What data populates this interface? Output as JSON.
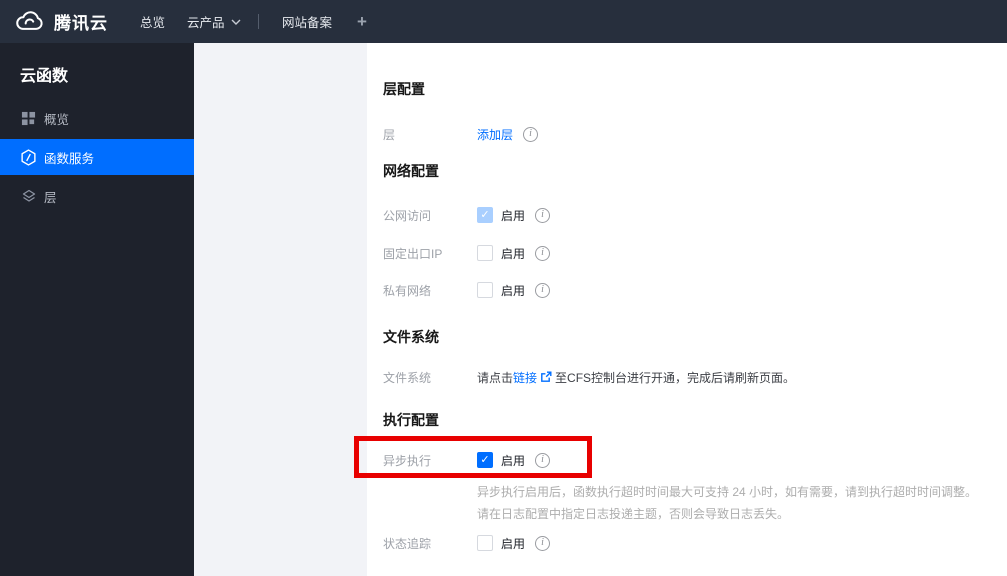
{
  "topbar": {
    "brand": "腾讯云",
    "nav": [
      {
        "label": "总览"
      },
      {
        "label": "云产品"
      },
      {
        "label": "网站备案"
      }
    ],
    "plus_label": "+"
  },
  "sidebar": {
    "title": "云函数",
    "items": [
      {
        "label": "概览",
        "icon": "grid-icon",
        "active": false
      },
      {
        "label": "函数服务",
        "icon": "function-icon",
        "active": true
      },
      {
        "label": "层",
        "icon": "layers-icon",
        "active": false
      }
    ]
  },
  "main": {
    "layer": {
      "title": "层配置",
      "label": "层",
      "link": "添加层"
    },
    "network": {
      "title": "网络配置",
      "rows": [
        {
          "label": "公网访问",
          "enable": "启用",
          "checkbox": "checked-disabled"
        },
        {
          "label": "固定出口IP",
          "enable": "启用",
          "checkbox": "unchecked"
        },
        {
          "label": "私有网络",
          "enable": "启用",
          "checkbox": "unchecked"
        }
      ]
    },
    "filesystem": {
      "title": "文件系统",
      "label": "文件系统",
      "before_link": "请点击",
      "link_text": "链接",
      "after_link": "至CFS控制台进行开通，完成后请刷新页面。"
    },
    "execution": {
      "title": "执行配置",
      "async_row": {
        "label": "异步执行",
        "enable": "启用",
        "checkbox": "checked"
      },
      "desc_line1": "异步执行启用后，函数执行超时时间最大可支持 24 小时，如有需要，请到执行超时时间调整。",
      "desc_line2": "请在日志配置中指定日志投递主题，否则会导致日志丢失。",
      "status_row": {
        "label": "状态追踪",
        "enable": "启用",
        "checkbox": "unchecked"
      }
    }
  },
  "colors": {
    "accent": "#006EFF",
    "topbar_bg": "#272F3D",
    "sidebar_bg": "#1E222C",
    "panel_bg": "#F2F3F7",
    "highlight_red": "#E80000",
    "checkbox_checked_disabled": "#A9CFFF"
  }
}
